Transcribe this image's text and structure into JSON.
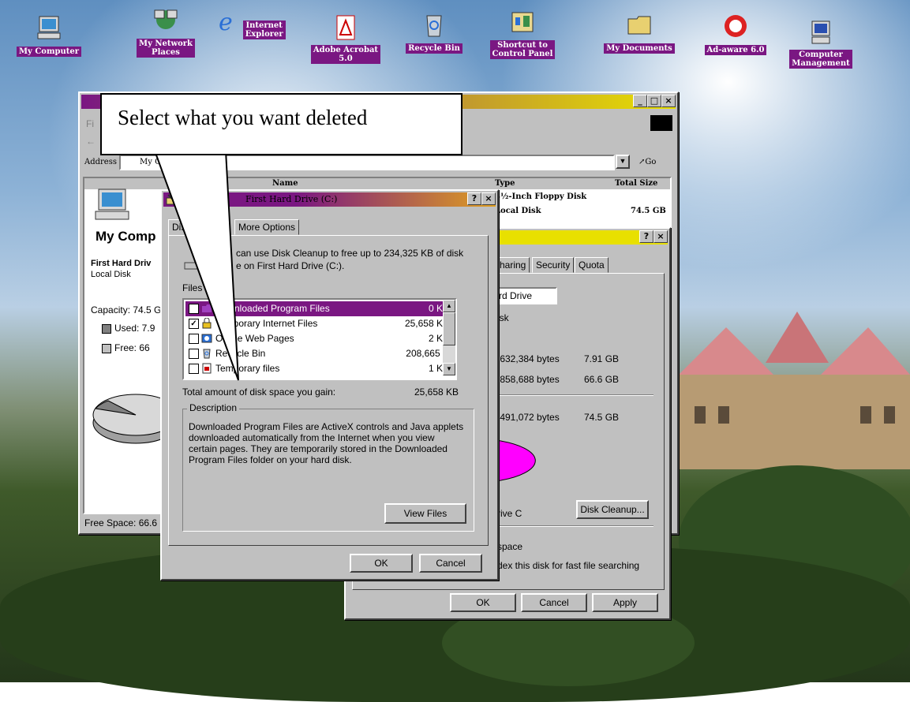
{
  "desktop": {
    "icons": [
      {
        "label": "My Computer",
        "icon": "computer-icon"
      },
      {
        "label": "My Network\nPlaces",
        "icon": "network-icon"
      },
      {
        "label": "Internet\nExplorer",
        "icon": "ie-icon"
      },
      {
        "label": "Adobe Acrobat\n5.0",
        "icon": "acrobat-icon"
      },
      {
        "label": "Recycle Bin",
        "icon": "recycle-bin-icon"
      },
      {
        "label": "Shortcut to\nControl Panel",
        "icon": "control-panel-icon"
      },
      {
        "label": "My Documents",
        "icon": "documents-icon"
      },
      {
        "label": "Ad-aware 6.0",
        "icon": "adaware-icon"
      },
      {
        "label": "Computer\nManagement",
        "icon": "management-icon"
      }
    ]
  },
  "callout": {
    "text": "Select what you want deleted"
  },
  "explorer": {
    "menu_partial": "Fi",
    "address_label": "Address",
    "address_value": "My Co",
    "go_label": "Go",
    "columns": {
      "name": "Name",
      "type": "Type",
      "total": "Total Size"
    },
    "rows": [
      {
        "type": "3½-Inch Floppy Disk",
        "size": ""
      },
      {
        "type": "Local Disk",
        "size": "74.5 GB"
      }
    ],
    "panel_title": "My Comp",
    "drive_name": "First Hard Driv",
    "drive_type": "Local Disk",
    "capacity": "Capacity: 74.5 G",
    "used": "Used: 7.9",
    "free": "Free: 66",
    "status": "Free Space: 66.6 G"
  },
  "properties": {
    "tabs": [
      "haring",
      "Security",
      "Quota"
    ],
    "name_value": "rd Drive",
    "type_partial": "isk",
    "used_bytes": ",632,384 bytes",
    "used_gb": "7.91 GB",
    "free_bytes": ",858,688 bytes",
    "free_gb": "66.6 GB",
    "cap_bytes": ",491,072 bytes",
    "cap_gb": "74.5 GB",
    "drive_label": "rive C",
    "disk_cleanup": "Disk Cleanup...",
    "compress_partial": "space",
    "index_partial": "dex this disk for fast file searching",
    "ok": "OK",
    "cancel": "Cancel",
    "apply": "Apply",
    "colors": {
      "free_pie": "#ff00ff"
    }
  },
  "cleanup": {
    "title": "First Hard Drive (C:)",
    "tab_partial": "Dis",
    "tab_more": "More Options",
    "intro_1": "can use Disk Cleanup to free up to 234,325 KB of disk",
    "intro_2": "e on First Hard Drive (C:).",
    "files_label": "Files to",
    "files": [
      {
        "checked": true,
        "name": "Downloaded Program Files",
        "size": "0 KB",
        "selected": true,
        "icon": "folder-icon"
      },
      {
        "checked": true,
        "name": "Temporary Internet Files",
        "size": "25,658 KB",
        "selected": false,
        "icon": "lock-icon"
      },
      {
        "checked": false,
        "name": "Offline Web Pages",
        "size": "2 KB",
        "selected": false,
        "icon": "offline-pages-icon"
      },
      {
        "checked": false,
        "name": "Recycle Bin",
        "size": "208,665 K",
        "selected": false,
        "icon": "recycle-bin-icon"
      },
      {
        "checked": false,
        "name": "Temporary files",
        "size": "1 KB",
        "selected": false,
        "icon": "temp-file-icon"
      }
    ],
    "total_label": "Total amount of disk space you gain:",
    "total_value": "25,658 KB",
    "description_label": "Description",
    "description": "Downloaded Program Files are ActiveX controls and Java applets downloaded automatically from the Internet when you view certain pages. They are temporarily stored in the Downloaded Program Files folder on your hard disk.",
    "view_files": "View Files",
    "ok": "OK",
    "cancel": "Cancel"
  }
}
